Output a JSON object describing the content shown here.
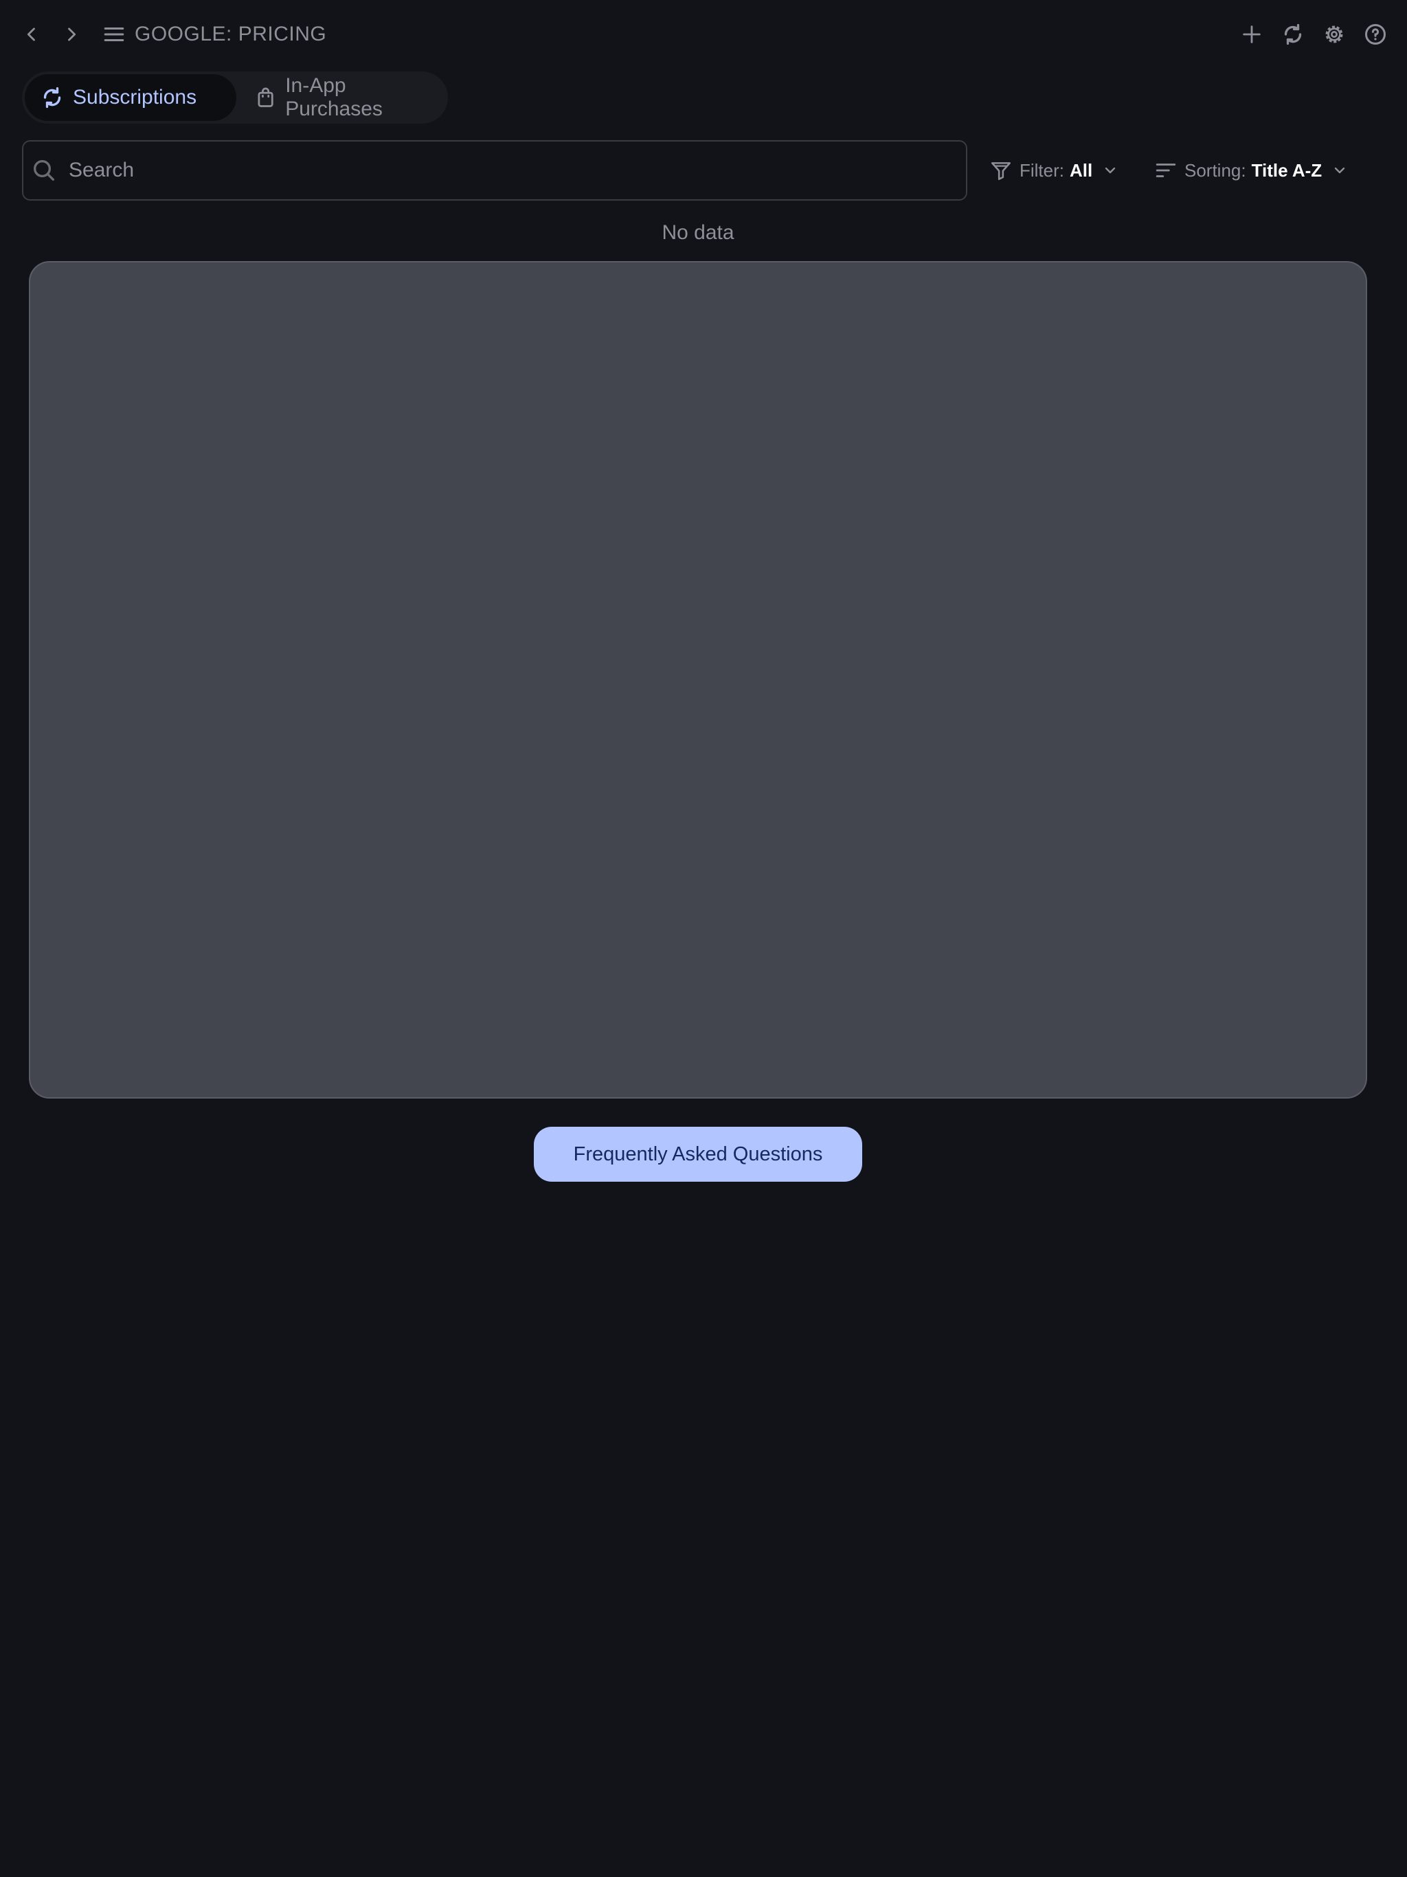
{
  "header": {
    "title": "GOOGLE: PRICING",
    "back_icon": "chevron-left-icon",
    "forward_icon": "chevron-right-icon",
    "menu_icon": "hamburger-icon",
    "actions": [
      "plus-icon",
      "refresh-icon",
      "gear-icon",
      "help-icon"
    ]
  },
  "tabs": [
    {
      "label": "Subscriptions",
      "icon": "refresh-icon",
      "selected": true
    },
    {
      "label": "In-App Purchases",
      "icon": "shopping-bag-icon",
      "selected": false
    }
  ],
  "search": {
    "placeholder": "Search",
    "value": ""
  },
  "filter": {
    "label": "Filter:",
    "value": "All"
  },
  "sorting": {
    "label": "Sorting:",
    "value": "Title A-Z"
  },
  "content": {
    "empty_text": "No data"
  },
  "faq": {
    "label": "Frequently Asked Questions"
  },
  "colors": {
    "background": "#121318",
    "accent": "#b3c5ff",
    "panel": "#44464f",
    "muted_text": "#8e9099"
  }
}
